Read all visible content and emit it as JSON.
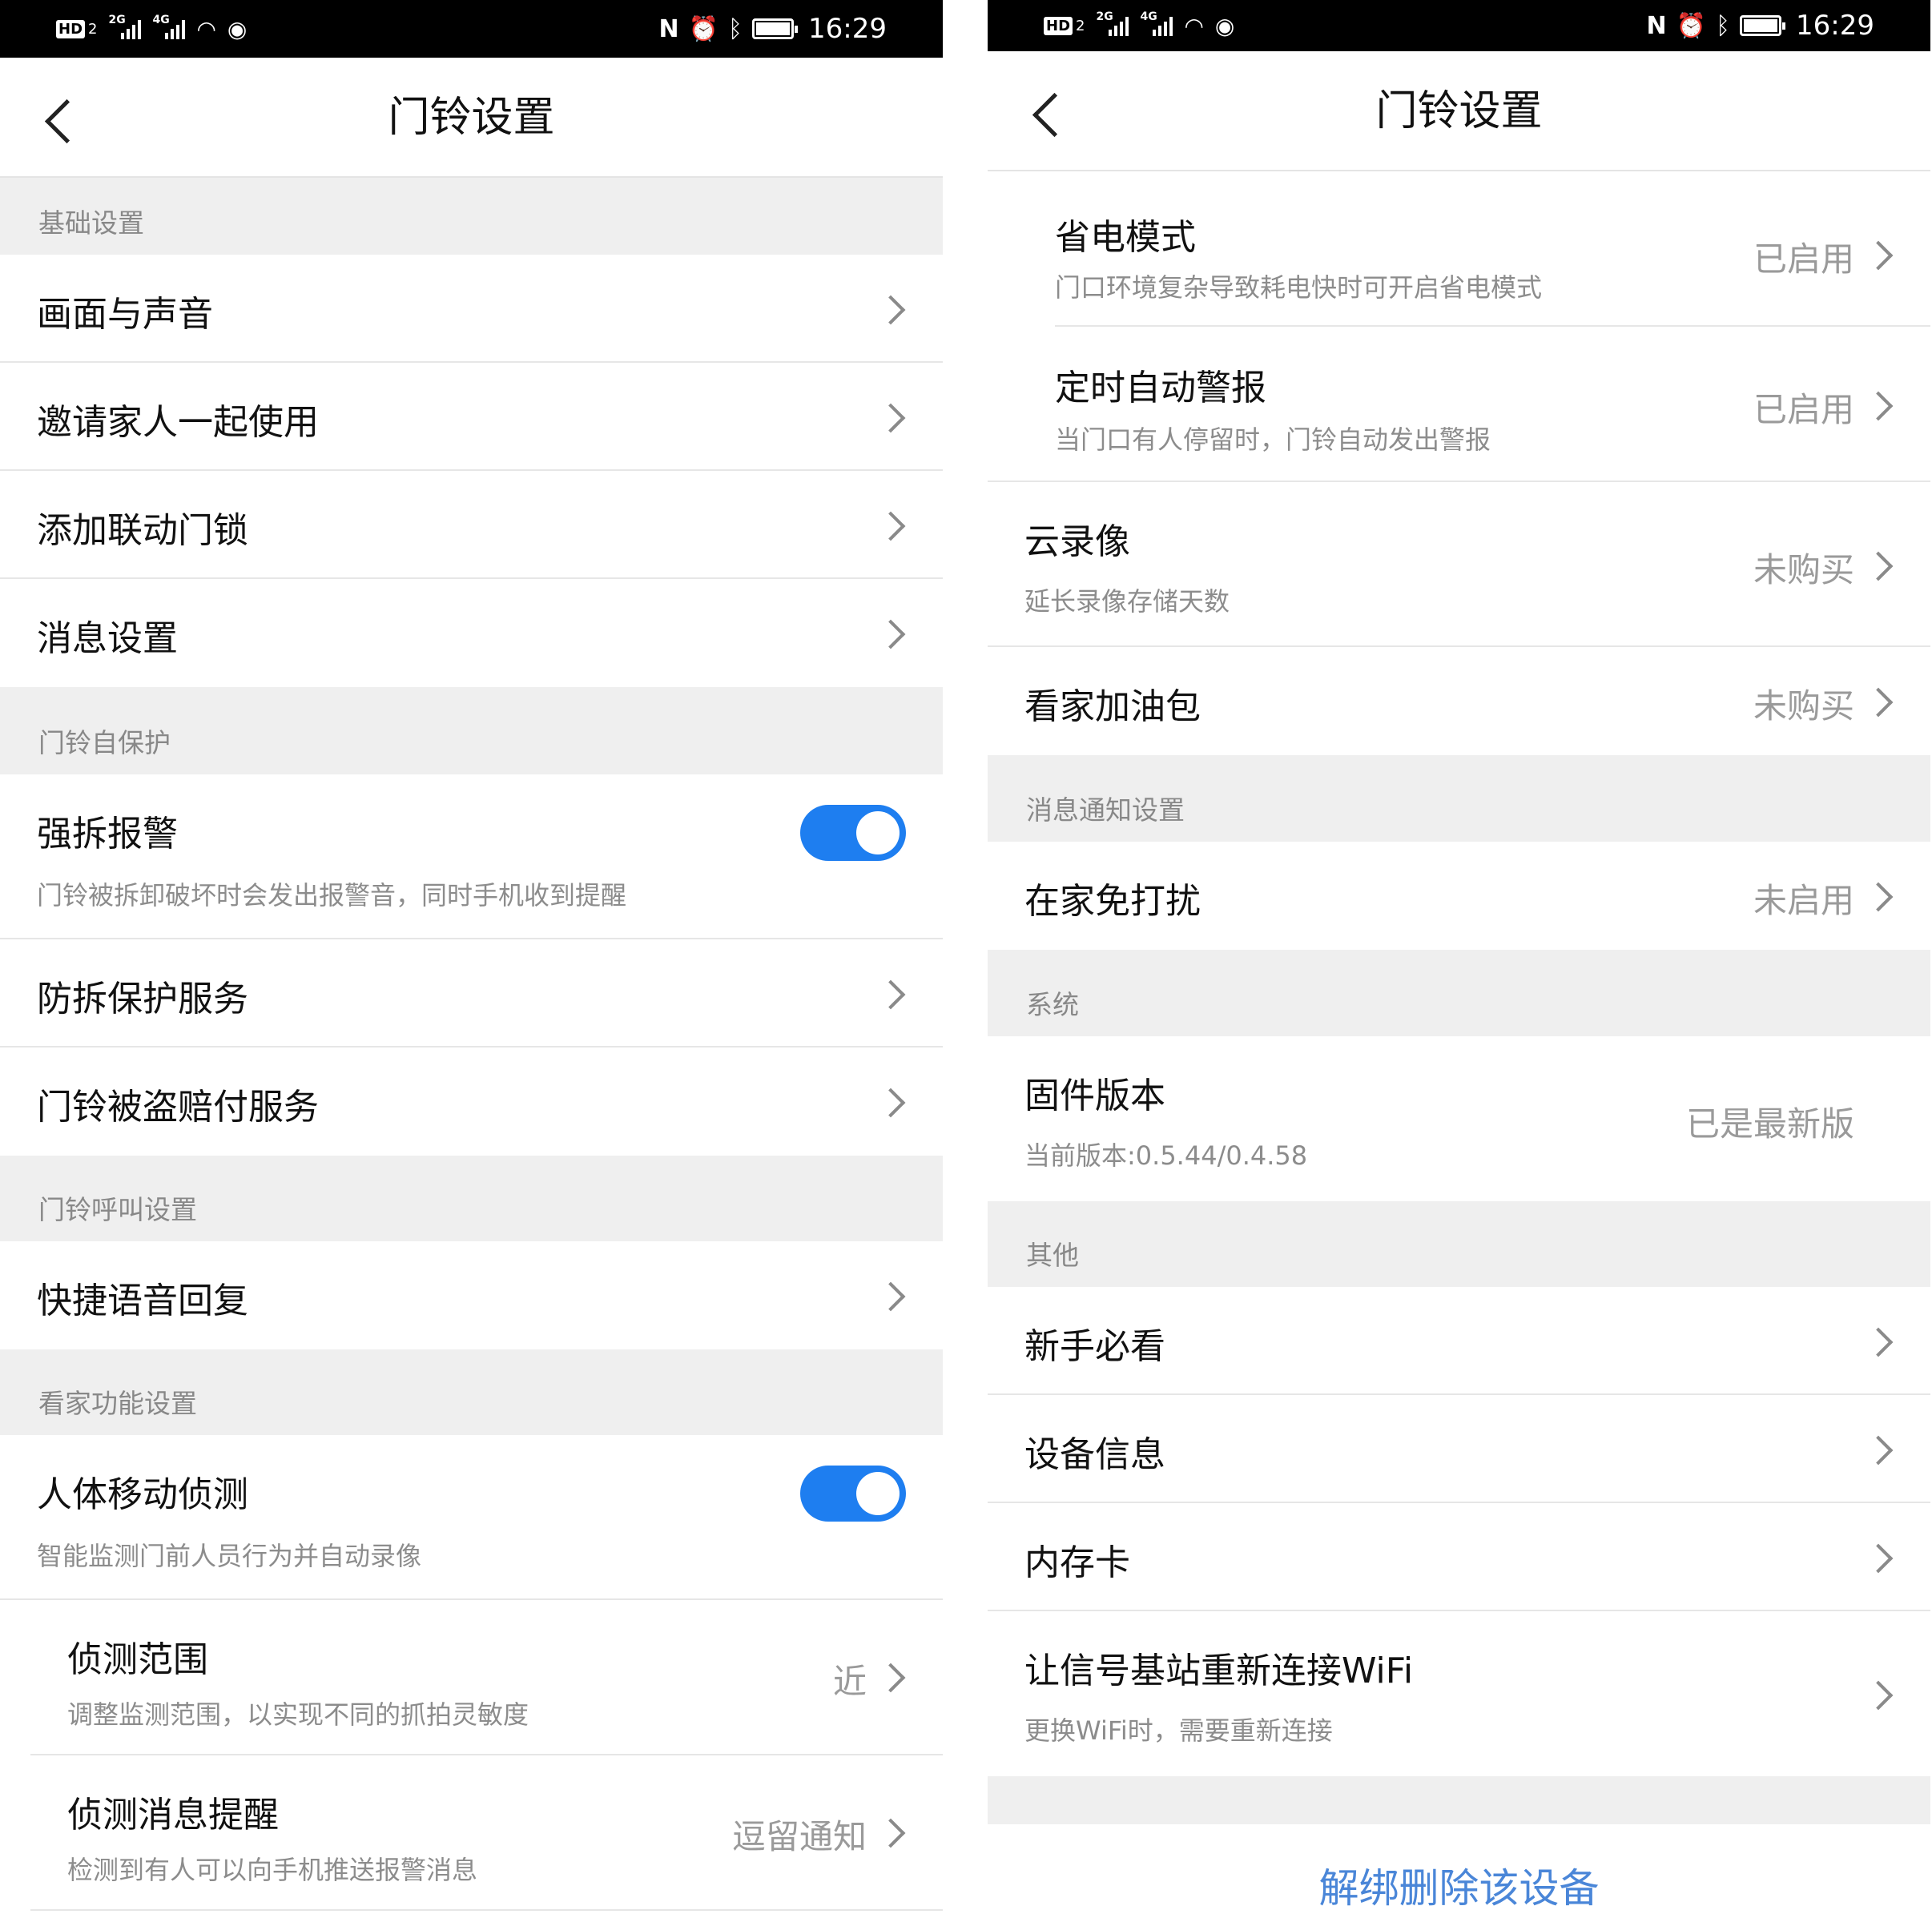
{
  "status_bar": {
    "left_badge": "HD",
    "sim2": "2",
    "net1": "2G",
    "net2": "4G",
    "time": "16:29",
    "icons": [
      "signal-icon",
      "wifi-icon",
      "eye-icon",
      "nfc-icon",
      "alarm-icon",
      "bluetooth-icon",
      "battery-icon"
    ]
  },
  "left": {
    "title": "门铃设置",
    "sections": {
      "basic": "基础设置",
      "protect": "门铃自保护",
      "call": "门铃呼叫设置",
      "guard": "看家功能设置"
    },
    "rows": {
      "picture_sound": "画面与声音",
      "invite_family": "邀请家人一起使用",
      "add_lock": "添加联动门锁",
      "message_settings": "消息设置",
      "tamper_alarm": "强拆报警",
      "tamper_alarm_sub": "门铃被拆卸破坏时会发出报警音，同时手机收到提醒",
      "tamper_service": "防拆保护服务",
      "theft_compensation": "门铃被盗赔付服务",
      "quick_reply": "快捷语音回复",
      "motion_detect": "人体移动侦测",
      "motion_detect_sub": "智能监测门前人员行为并自动录像",
      "detect_range": "侦测范围",
      "detect_range_sub": "调整监测范围，以实现不同的抓拍灵敏度",
      "detect_range_value": "近",
      "detect_notify": "侦测消息提醒",
      "detect_notify_sub": "检测到有人可以向手机推送报警消息",
      "detect_notify_value": "逗留通知"
    },
    "toggles": {
      "tamper_alarm_on": true,
      "motion_detect_on": true
    }
  },
  "right": {
    "title": "门铃设置",
    "sections": {
      "notify": "消息通知设置",
      "system": "系统",
      "other": "其他"
    },
    "rows": {
      "power_save": "省电模式",
      "power_save_sub": "门口环境复杂导致耗电快时可开启省电模式",
      "power_save_value": "已启用",
      "timed_alarm": "定时自动警报",
      "timed_alarm_sub": "当门口有人停留时，门铃自动发出警报",
      "timed_alarm_value": "已启用",
      "cloud_record": "云录像",
      "cloud_record_sub": "延长录像存储天数",
      "cloud_record_value": "未购买",
      "guard_pack": "看家加油包",
      "guard_pack_value": "未购买",
      "do_not_disturb": "在家免打扰",
      "do_not_disturb_value": "未启用",
      "firmware": "固件版本",
      "firmware_sub": "当前版本:0.5.44/0.4.58",
      "firmware_value": "已是最新版",
      "beginner": "新手必看",
      "device_info": "设备信息",
      "memory_card": "内存卡",
      "reconnect_wifi": "让信号基站重新连接WiFi",
      "reconnect_wifi_sub": "更换WiFi时，需要重新连接"
    },
    "unbind": "解绑删除该设备"
  },
  "colors": {
    "accent": "#1e7ef0",
    "link": "#4a86d8",
    "section_bg": "#efefef"
  }
}
